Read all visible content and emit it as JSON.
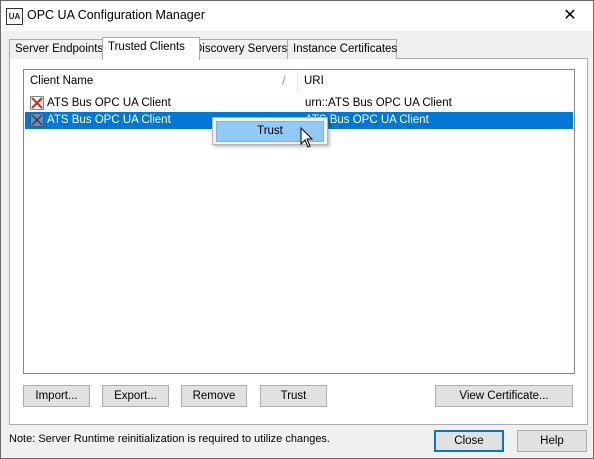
{
  "window": {
    "title": "OPC UA Configuration Manager",
    "app_icon_text": "UA"
  },
  "tabs": [
    {
      "label": "Server Endpoints"
    },
    {
      "label": "Trusted Clients"
    },
    {
      "label": "Discovery Servers"
    },
    {
      "label": "Instance Certificates"
    }
  ],
  "active_tab": "Trusted Clients",
  "list": {
    "columns": [
      "Client Name",
      "URI"
    ],
    "rows": [
      {
        "name": "ATS Bus OPC UA Client",
        "uri": "urn::ATS Bus OPC UA Client",
        "icon": "rejected-certificate-icon",
        "selected": false
      },
      {
        "name": "ATS Bus OPC UA Client",
        "uri": "ATS Bus OPC UA Client",
        "icon": "certificate-icon",
        "selected": true
      }
    ]
  },
  "context_menu": {
    "items": [
      "Trust"
    ]
  },
  "buttons": {
    "import": "Import...",
    "export": "Export...",
    "remove": "Remove",
    "trust": "Trust",
    "view_certificate": "View Certificate...",
    "close": "Close",
    "help": "Help"
  },
  "status": {
    "note": "Note:  Server Runtime reinitialization is required to utilize changes."
  },
  "colors": {
    "selection": "#0078d7",
    "menu_highlight": "#91c9f7"
  }
}
